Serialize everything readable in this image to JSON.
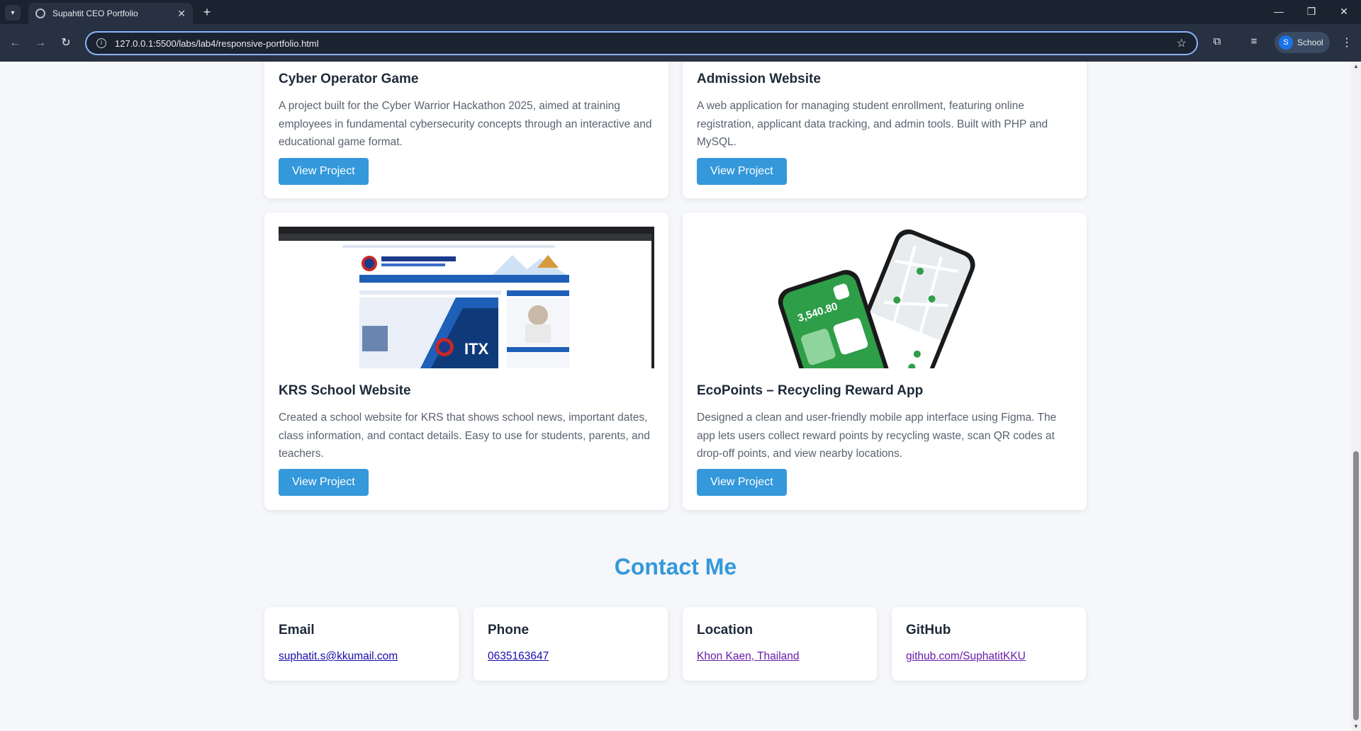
{
  "browser": {
    "tab_title": "Supahtit CEO Portfolio",
    "url": "127.0.0.1:5500/labs/lab4/responsive-portfolio.html",
    "profile_initial": "S",
    "profile_name": "School"
  },
  "projects": [
    {
      "title": "Cyber Operator Game",
      "description": "A project built for the Cyber Warrior Hackathon 2025, aimed at training employees in fundamental cybersecurity concepts through an interactive and educational game format.",
      "button": "View Project"
    },
    {
      "title": "Admission Website",
      "description": "A web application for managing student enrollment, featuring online registration, applicant data tracking, and admin tools. Built with PHP and MySQL.",
      "button": "View Project"
    },
    {
      "title": "KRS School Website",
      "description": "Created a school website for KRS that shows school news, important dates, class information, and contact details. Easy to use for students, parents, and teachers.",
      "button": "View Project",
      "image_text": "ITX"
    },
    {
      "title": "EcoPoints – Recycling Reward App",
      "description": "Designed a clean and user-friendly mobile app interface using Figma. The app lets users collect reward points by recycling waste, scan QR codes at drop-off points, and view nearby locations.",
      "button": "View Project",
      "image_text": "3,540.80"
    }
  ],
  "contact": {
    "heading": "Contact Me",
    "items": [
      {
        "label": "Email",
        "value": "suphatit.s@kkumail.com"
      },
      {
        "label": "Phone",
        "value": "0635163647"
      },
      {
        "label": "Location",
        "value": "Khon Kaen, Thailand"
      },
      {
        "label": "GitHub",
        "value": "github.com/SuphatitKKU"
      }
    ]
  },
  "colors": {
    "accent": "#3498db",
    "page_bg": "#f5f7fa",
    "heading": "#1e2a3a",
    "body_text": "#5a6270"
  }
}
